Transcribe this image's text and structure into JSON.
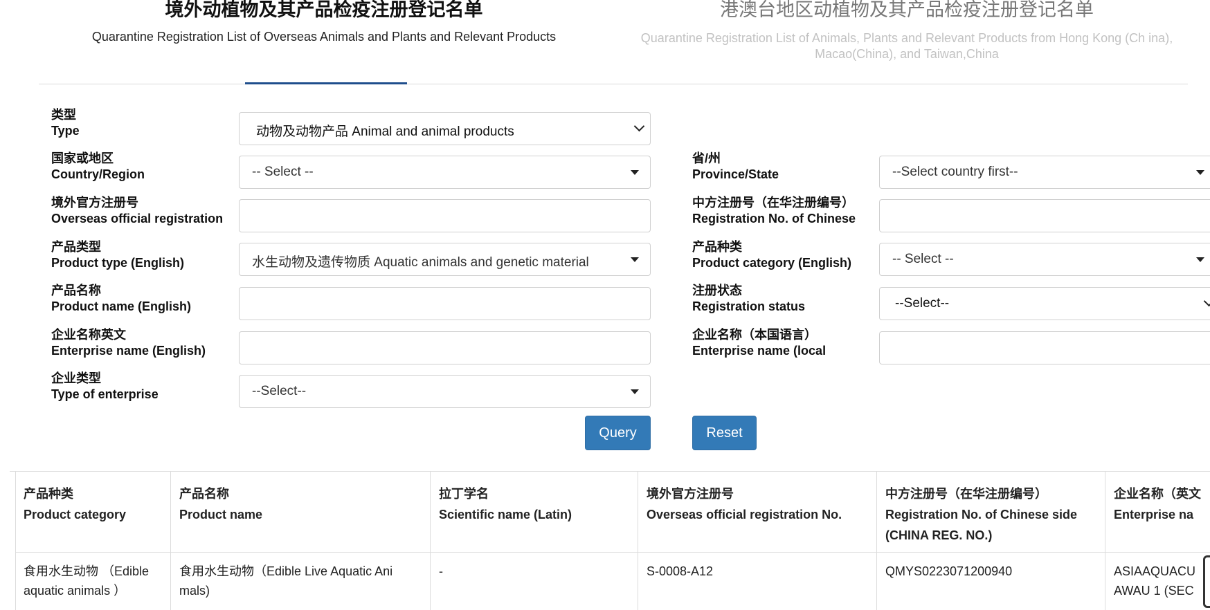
{
  "tabs": [
    {
      "title": "境外动植物及其产品检疫注册登记名单",
      "subtitle": "Quarantine Registration List of Overseas Animals and Plants and Relevant Products"
    },
    {
      "title": "港澳台地区动植物及其产品检疫注册登记名单",
      "subtitle": "Quarantine Registration List of Animals, Plants and Relevant Products from Hong Kong (Ch ina), Macao(China), and Taiwan,China"
    }
  ],
  "form": {
    "type": {
      "label_cn": "类型",
      "label_en": "Type",
      "value": "动物及动物产品 Animal and animal products"
    },
    "country": {
      "label_cn": "国家或地区",
      "label_en": "Country/Region",
      "value": "-- Select --"
    },
    "province": {
      "label_cn": "省/州",
      "label_en": "Province/State",
      "value": "--Select country first--"
    },
    "overseas_reg": {
      "label_cn": "境外官方注册号",
      "label_en": "Overseas official registration",
      "value": ""
    },
    "chinese_reg": {
      "label_cn": "中方注册号（在华注册编号）",
      "label_en": "Registration No. of Chinese",
      "value": ""
    },
    "product_type": {
      "label_cn": "产品类型",
      "label_en": "Product type (English)",
      "value": "水生动物及遗传物质 Aquatic animals and genetic material"
    },
    "product_category": {
      "label_cn": "产品种类",
      "label_en": "Product category (English)",
      "value": "-- Select --"
    },
    "product_name": {
      "label_cn": "产品名称",
      "label_en": "Product name (English)",
      "value": ""
    },
    "reg_status": {
      "label_cn": "注册状态",
      "label_en": "Registration status",
      "value": "--Select--"
    },
    "enterprise_en": {
      "label_cn": "企业名称英文",
      "label_en": "Enterprise name (English)",
      "value": ""
    },
    "enterprise_local": {
      "label_cn": "企业名称（本国语言）",
      "label_en": "Enterprise name (local",
      "value": ""
    },
    "enterprise_type": {
      "label_cn": "企业类型",
      "label_en": "Type of enterprise",
      "value": "--Select--"
    }
  },
  "buttons": {
    "query": "Query",
    "reset": "Reset"
  },
  "table": {
    "headers": [
      {
        "cn": "产品种类",
        "en": "Product category"
      },
      {
        "cn": "产品名称",
        "en": "Product name"
      },
      {
        "cn": "拉丁学名",
        "en": "Scientific name (Latin)"
      },
      {
        "cn": "境外官方注册号",
        "en": "Overseas official registration No."
      },
      {
        "cn": "中方注册号（在华注册编号）",
        "en": "Registration No. of Chinese side (CHINA REG. NO.)"
      },
      {
        "cn": "企业名称（英文",
        "en": "Enterprise na"
      }
    ],
    "rows": [
      [
        "食用水生动物 （Edible aquatic animals ）",
        "食用水生动物（Edible Live Aquatic Ani mals)",
        "-",
        "S-0008-A12",
        "QMYS0223071200940",
        "ASIAAQUACU AWAU 1 (SEC"
      ]
    ]
  }
}
